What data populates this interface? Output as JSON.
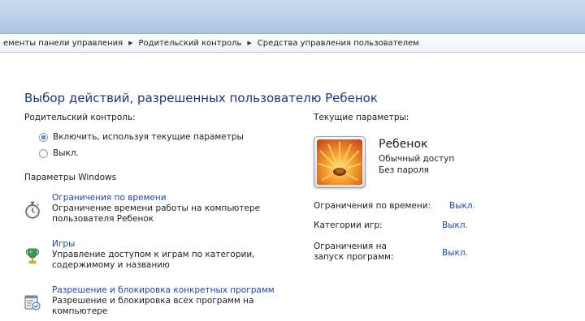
{
  "breadcrumb": {
    "items": [
      "ементы панели управления",
      "Родительский контроль",
      "Средства управления пользователем"
    ]
  },
  "main": {
    "title": "Выбор действий, разрешенных пользователю Ребенок",
    "parental_control_label": "Родительский контроль:",
    "radio_on": "Включить, используя текущие параметры",
    "radio_off": "Выкл.",
    "radio_selected": "on",
    "windows_settings_label": "Параметры Windows",
    "options": [
      {
        "icon": "stopwatch-icon",
        "title": "Ограничения по времени",
        "desc": "Ограничение времени работы на компьютере пользователя Ребенок"
      },
      {
        "icon": "trophy-icon",
        "title": "Игры",
        "desc": "Управление доступом к играм по категории, содержимому и названию"
      },
      {
        "icon": "program-block-icon",
        "title": "Разрешение и блокировка конкретных программ",
        "desc": "Разрешение и блокировка всех программ на компьютере"
      }
    ]
  },
  "current": {
    "label": "Текущие параметры:",
    "user_name": "Ребенок",
    "account_type": "Обычный доступ",
    "password_status": "Без пароля",
    "settings": [
      {
        "label": "Ограничения по времени:",
        "value": "Выкл."
      },
      {
        "label": "Категории игр:",
        "value": "Выкл."
      },
      {
        "label": "Ограничения на запуск программ:",
        "value": "Выкл."
      }
    ]
  },
  "colors": {
    "title": "#1e3287",
    "link": "#1a46b8"
  }
}
